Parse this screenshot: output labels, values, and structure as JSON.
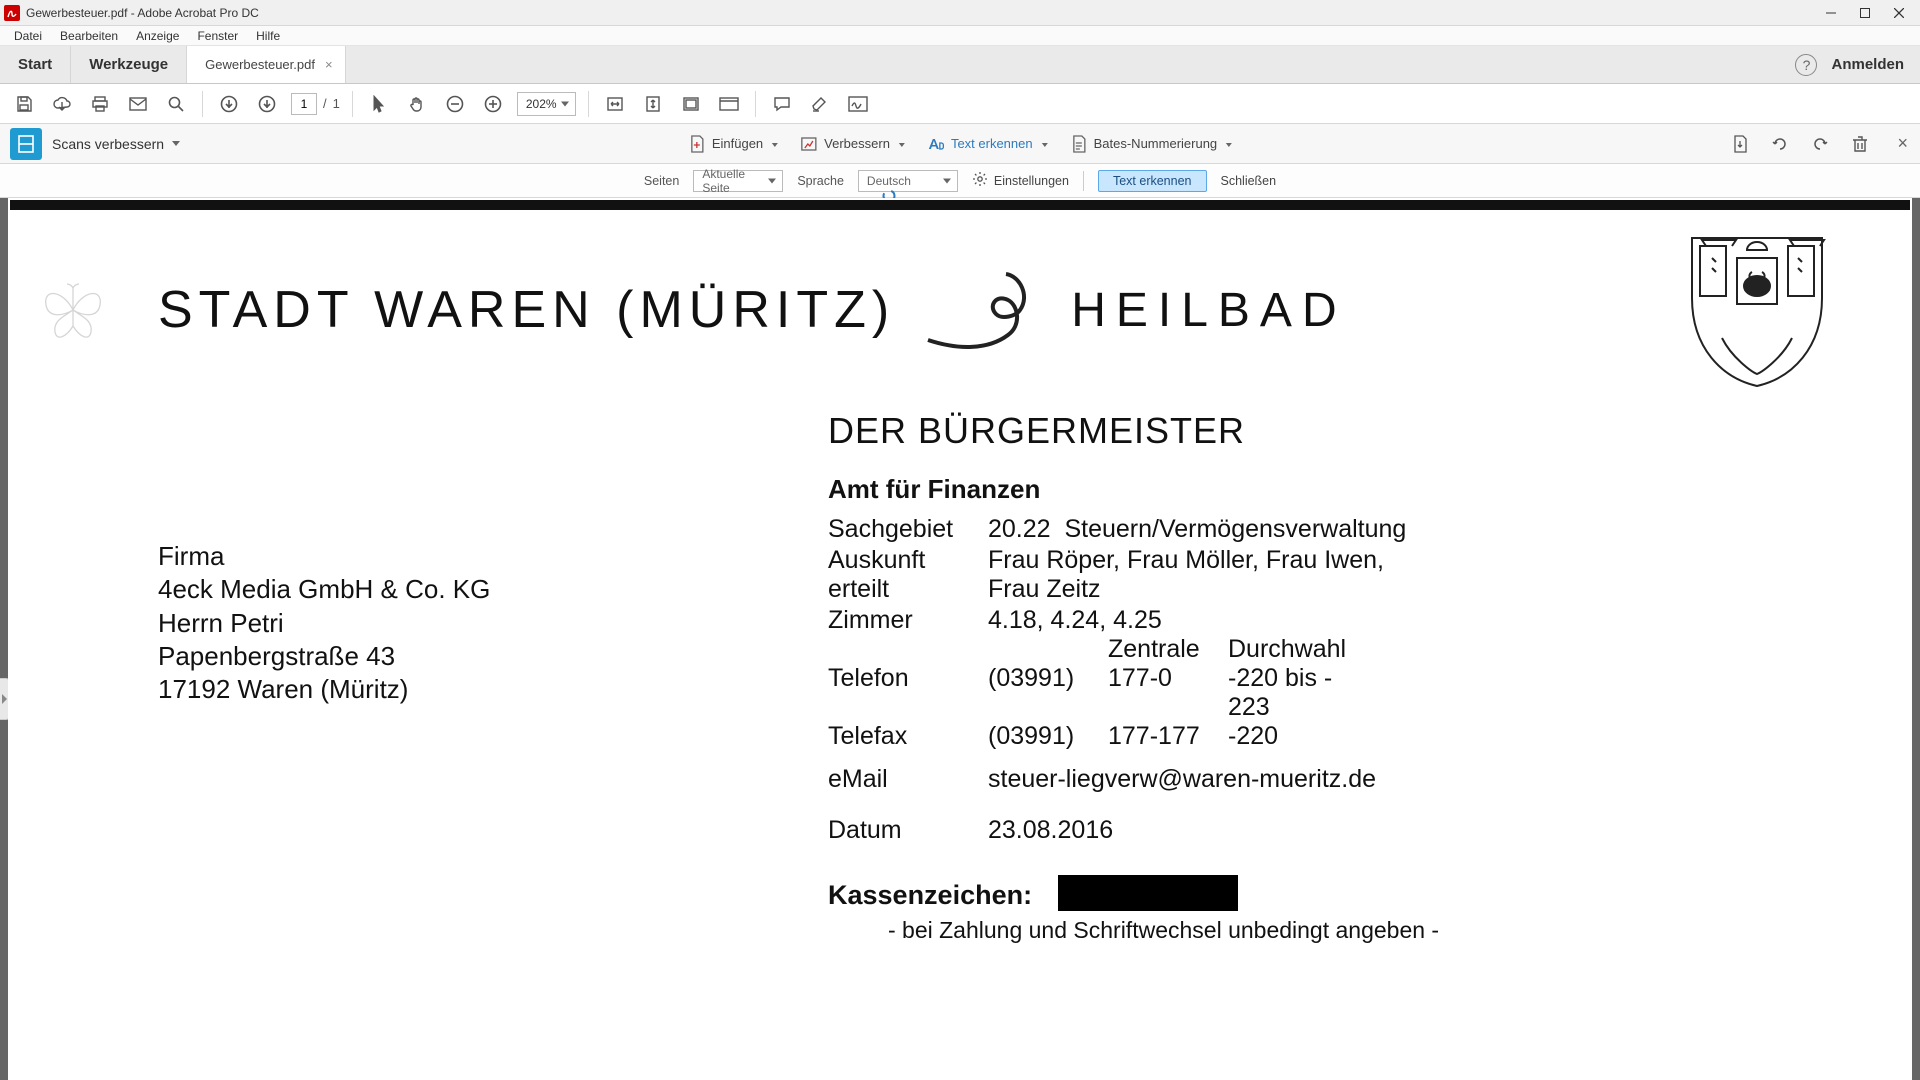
{
  "window": {
    "title": "Gewerbesteuer.pdf - Adobe Acrobat Pro DC"
  },
  "menu": {
    "file": "Datei",
    "edit": "Bearbeiten",
    "view": "Anzeige",
    "window": "Fenster",
    "help": "Hilfe"
  },
  "nav": {
    "start": "Start",
    "tools": "Werkzeuge",
    "doc_tab": "Gewerbesteuer.pdf",
    "signin": "Anmelden"
  },
  "toolbar": {
    "page_current": "1",
    "page_sep": "/",
    "page_total": "1",
    "zoom": "202%"
  },
  "scanbar": {
    "title": "Scans verbessern",
    "insert": "Einfügen",
    "enhance": "Verbessern",
    "recognize": "Text erkennen",
    "bates": "Bates-Nummerierung"
  },
  "ocrbar": {
    "pages_label": "Seiten",
    "pages_value": "Aktuelle Seite",
    "lang_label": "Sprache",
    "lang_value": "Deutsch",
    "settings": "Einstellungen",
    "run": "Text erkennen",
    "close": "Schließen"
  },
  "doc": {
    "city": "STADT WAREN (MÜRITZ)",
    "heilbad": "HEILBAD",
    "mayor": "DER BÜRGERMEISTER",
    "amt": "Amt für Finanzen",
    "sach_l": "Sachgebiet",
    "sach_v": "20.22  Steuern/Vermögensverwaltung",
    "ausk_l": "Auskunft erteilt",
    "ausk_v": "Frau Röper, Frau Möller, Frau Iwen,\nFrau Zeitz",
    "zimmer_l": "Zimmer",
    "zimmer_v": "4.18, 4.24, 4.25",
    "zentrale": "Zentrale",
    "durchwahl": "Durchwahl",
    "tel_l": "Telefon",
    "tel_pre": "(03991)",
    "tel_z": "177-0",
    "tel_d": "-220 bis - 223",
    "fax_l": "Telefax",
    "fax_pre": "(03991)",
    "fax_z": "177-177",
    "fax_d": "-220",
    "email_l": "eMail",
    "email_v": "steuer-liegverw@waren-mueritz.de",
    "datum_l": "Datum",
    "datum_v": "23.08.2016",
    "kz_l": "Kassenzeichen:",
    "kz_note": "- bei Zahlung und Schriftwechsel unbedingt angeben -",
    "addr1": "Firma",
    "addr2": "4eck Media GmbH & Co. KG",
    "addr3": "Herrn Petri",
    "addr4": "Papenbergstraße 43",
    "addr5": "17192 Waren (Müritz)"
  }
}
